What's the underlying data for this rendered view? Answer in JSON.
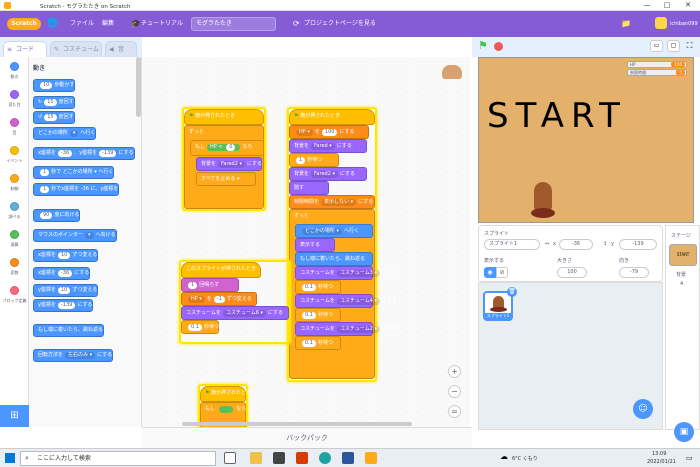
{
  "window": {
    "title": "Scratch - モグラたたき on Scratch",
    "controls": [
      "—",
      "□",
      "✕"
    ]
  },
  "menubar": {
    "logo": "Scratch",
    "globe": "globe-icon",
    "file": "ファイル",
    "edit": "編集",
    "tutorial": "チュートリアル",
    "project_title": "モグラたたき",
    "project_page": "プロジェクトページを見る",
    "username": "ichiban099",
    "colors": {
      "bar": "#855cd6"
    }
  },
  "tabs": {
    "code": "コード",
    "costumes": "コスチューム",
    "sounds": "音"
  },
  "categories": [
    {
      "label": "動き",
      "color": "#4c97ff"
    },
    {
      "label": "見た目",
      "color": "#9966ff"
    },
    {
      "label": "音",
      "color": "#cf63cf"
    },
    {
      "label": "イベント",
      "color": "#ffbf00"
    },
    {
      "label": "制御",
      "color": "#ffab19"
    },
    {
      "label": "調べる",
      "color": "#5cb1d6"
    },
    {
      "label": "演算",
      "color": "#59c059"
    },
    {
      "label": "変数",
      "color": "#ff8c1a"
    },
    {
      "label": "ブロック定義",
      "color": "#ff6680"
    }
  ],
  "palette": {
    "heading": "動き",
    "blocks": [
      {
        "pre": "",
        "pill": "10",
        "post": "歩動かす"
      },
      {
        "pre": "",
        "pill": "15",
        "post": "度回す",
        "icon": "↻"
      },
      {
        "pre": "",
        "pill": "15",
        "post": "度回す",
        "icon": "↺"
      },
      {
        "pre": "どこかの場所",
        "drop": "▾",
        "post": "へ行く"
      },
      {
        "pre": "x座標を",
        "pill": "-36",
        "mid": "、y座標を",
        "pill2": "-139",
        "post": "にする"
      },
      {
        "pre": "",
        "pill": "1",
        "post": "秒で どこかの場所 ▾ へ行く"
      },
      {
        "pre": "",
        "pill": "1",
        "post": "秒でx座標を -36 に、y座標を"
      },
      {
        "pre": "",
        "pill": "90",
        "post": "度に向ける"
      },
      {
        "pre": "マウスのポインター",
        "drop": "▾",
        "post": "へ向ける"
      },
      {
        "pre": "x座標を",
        "pill": "10",
        "post": "ずつ変える"
      },
      {
        "pre": "x座標を",
        "pill": "-36",
        "post": "にする"
      },
      {
        "pre": "y座標を",
        "pill": "10",
        "post": "ずつ変える"
      },
      {
        "pre": "y座標を",
        "pill": "-139",
        "post": "にする"
      },
      {
        "pre": "もし端に着いたら、跳ね返る",
        "pill": "",
        "post": ""
      },
      {
        "pre": "回転方法を",
        "drop": "左右のみ ▾",
        "post": "にする"
      }
    ]
  },
  "workspace": {
    "script1": [
      "旗が押されたとき",
      "ずっと",
      "もし",
      "HP",
      "<",
      "0",
      "なら",
      "背景を",
      "Fared2 ▾",
      "にする",
      "すべてを止める ▾"
    ],
    "script2": [
      "旗が押されたとき",
      "HP ▾",
      "を",
      "100",
      "にする",
      "背景を",
      "Fared ▾",
      "にする",
      "1",
      "秒待つ",
      "背景を",
      "Fared2 ▾",
      "にする",
      "隠す",
      "制限時間",
      "を",
      "表示しない ▾",
      "にする",
      "ずっと",
      "どこかの場所 ▾",
      "へ行く",
      "表示する",
      "もし端に着いたら、跳ね返る",
      "コスチュームを",
      "コスチューム3 ▾",
      "にする",
      "0.1",
      "秒待つ",
      "コスチュームを",
      "コスチューム4 ▾",
      "にする",
      "0.1",
      "秒待つ",
      "コスチュームを",
      "コスチューム2 ▾",
      "にする",
      "0.1",
      "秒待つ"
    ],
    "script3": [
      "このスプライトが押されたとき",
      "1",
      "回鳴らす",
      "HP ▾",
      "を",
      "-1",
      "ずつ変える",
      "コスチュームを",
      "コスチューム6 ▾",
      "にする",
      "0.1",
      "秒待つ"
    ],
    "script4": [
      "旗が押されたとき",
      "もし",
      "なら"
    ],
    "zoom": [
      "+",
      "−",
      "="
    ]
  },
  "backpack": "バックパック",
  "stage": {
    "text": "START",
    "monitors": [
      {
        "label": "HP",
        "value": "100"
      },
      {
        "label": "制限時間",
        "value": "0"
      }
    ],
    "bg": "#e4b16d"
  },
  "sprite": {
    "label": "スプライト",
    "name": "スプライト1",
    "x_label": "x",
    "x": "-36",
    "y_label": "y",
    "y": "-139",
    "show_label": "表示する",
    "size_label": "大きさ",
    "size": "100",
    "dir_label": "向き",
    "dir": "-79",
    "thumb_label": "スプライト1"
  },
  "stagepane": {
    "title": "ステージ",
    "backdrops_label": "背景",
    "backdrops": "4"
  },
  "taskbar": {
    "search": "ここに入力して検索",
    "weather": "6°C くもり",
    "time": "13:09",
    "date": "2022/01/21"
  }
}
